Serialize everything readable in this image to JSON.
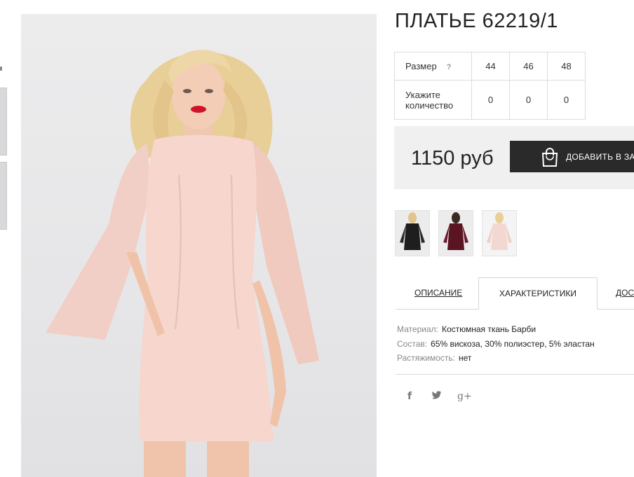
{
  "product": {
    "title": "ПЛАТЬЕ 62219/1",
    "main_image": "pink dress model photo"
  },
  "size_table": {
    "size_label": "Размер",
    "help": "?",
    "sizes": [
      "44",
      "46",
      "48"
    ],
    "qty_label_line1": "Укажите",
    "qty_label_line2": "количество",
    "quantities": [
      "0",
      "0",
      "0"
    ]
  },
  "buy": {
    "price": "1150 руб",
    "add_label": "ДОБАВИТЬ В ЗАКАЗ",
    "button_color": "#2a2a2a"
  },
  "color_variants": [
    {
      "name": "black",
      "color": "#1e1e1e"
    },
    {
      "name": "burgundy",
      "color": "#5a1422"
    },
    {
      "name": "pink",
      "color": "#f3d8d2"
    }
  ],
  "tabs": {
    "description": "ОПИСАНИЕ",
    "characteristics": "ХАРАКТЕРИСТИКИ",
    "delivery": "ДОСТАВКА"
  },
  "specs": [
    {
      "key": "Материал:",
      "value": "Костюмная ткань Барби"
    },
    {
      "key": "Состав:",
      "value": "65% вискоза, 30% полиэстер, 5% эластан"
    },
    {
      "key": "Растяжимость:",
      "value": "нет"
    }
  ],
  "social": {
    "facebook": "f",
    "twitter": "twitter-icon",
    "googleplus": "g+"
  }
}
